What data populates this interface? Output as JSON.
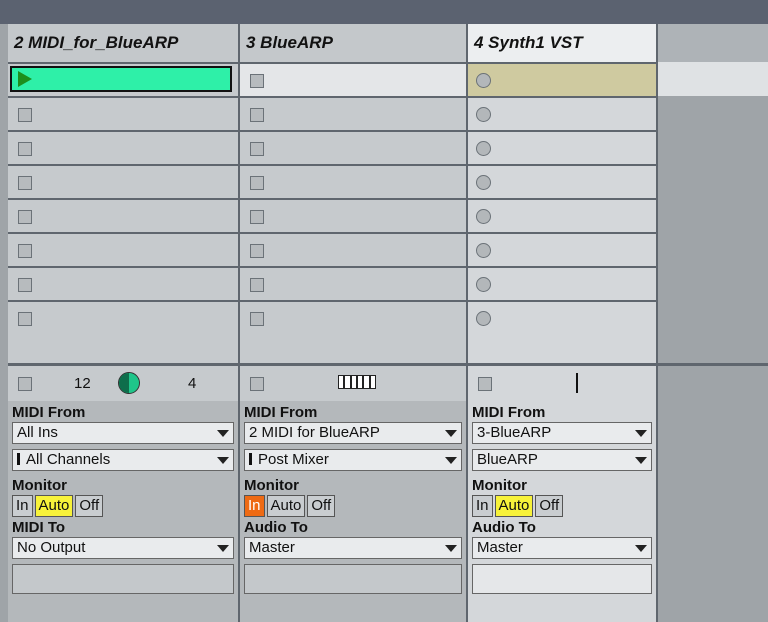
{
  "tracks": [
    {
      "name": "2 MIDI_for_BlueARP",
      "strip": {
        "left_number": "12",
        "right_number": "4"
      },
      "io": {
        "from_label": "MIDI From",
        "from_value": "All Ins",
        "channel_value": "All Channels",
        "monitor_label": "Monitor",
        "monitor": [
          "In",
          "Auto",
          "Off"
        ],
        "monitor_active": "Auto",
        "to_label": "MIDI To",
        "to_value": "No Output"
      }
    },
    {
      "name": "3 BlueARP",
      "io": {
        "from_label": "MIDI From",
        "from_value": "2 MIDI for BlueARP",
        "channel_value": "Post Mixer",
        "monitor_label": "Monitor",
        "monitor": [
          "In",
          "Auto",
          "Off"
        ],
        "monitor_active": "In",
        "to_label": "Audio To",
        "to_value": "Master"
      }
    },
    {
      "name": "4 Synth1 VST",
      "io": {
        "from_label": "MIDI From",
        "from_value": "3-BlueARP",
        "channel_value": "BlueARP",
        "monitor_label": "Monitor",
        "monitor": [
          "In",
          "Auto",
          "Off"
        ],
        "monitor_active": "Auto",
        "to_label": "Audio To",
        "to_value": "Master"
      }
    }
  ],
  "colors": {
    "playing_clip": "#2ef0a8",
    "monitor_auto": "#f7f23a",
    "monitor_in": "#ee6a13"
  }
}
